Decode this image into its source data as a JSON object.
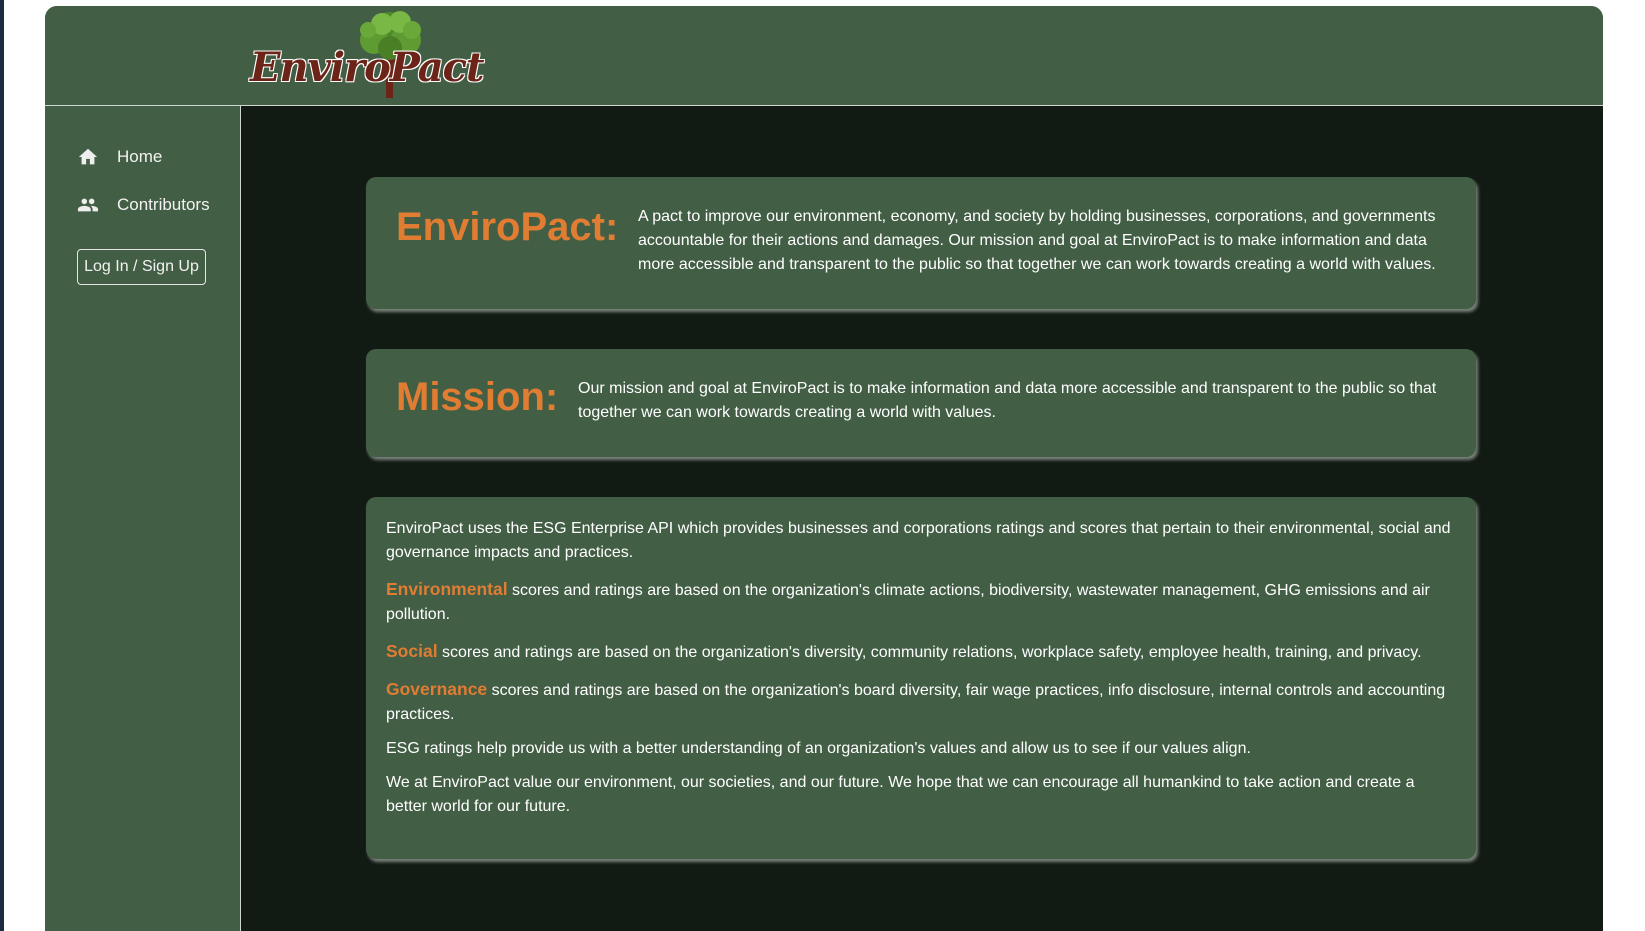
{
  "header": {
    "logo_text": "EnviroPact"
  },
  "sidebar": {
    "items": [
      {
        "label": "Home",
        "icon": "home-icon"
      },
      {
        "label": "Contributors",
        "icon": "people-icon"
      }
    ],
    "login_label": "Log In / Sign Up"
  },
  "main": {
    "about": {
      "title": "EnviroPact:",
      "text": "A pact to improve our environment, economy, and society by holding businesses, corporations, and governments accountable for their actions and damages. Our mission and goal at EnviroPact is to make information and data more accessible and transparent to the public so that together we can work towards creating a world with values."
    },
    "mission": {
      "title": "Mission:",
      "text": "Our mission and goal at EnviroPact is to make information and data more accessible and transparent to the public so that together we can work towards creating a world with values."
    },
    "esg": {
      "intro": "EnviroPact uses the ESG Enterprise API which provides businesses and corporations ratings and scores that pertain to their environmental, social and governance impacts and practices.",
      "environmental_label": "Environmental",
      "environmental_text": " scores and ratings are based on the organization's climate actions, biodiversity, wastewater management, GHG emissions and air pollution.",
      "social_label": "Social",
      "social_text": " scores and ratings are based on the organization's diversity, community relations, workplace safety, employee health, training, and privacy.",
      "governance_label": "Governance",
      "governance_text": " scores and ratings are based on the organization's board diversity, fair wage practices, info disclosure, internal controls and accounting practices.",
      "ratings_note": "ESG ratings help provide us with a better understanding of an organization's values and allow us to see if our values align.",
      "closing": "We at EnviroPact value our environment, our societies, and our future. We hope that we can encourage all humankind to take action and create a better world for our future."
    }
  },
  "colors": {
    "panel_green": "#425e45",
    "dark_background": "#121a14",
    "accent_orange": "#e07d33",
    "logo_brown": "#6d2418"
  }
}
